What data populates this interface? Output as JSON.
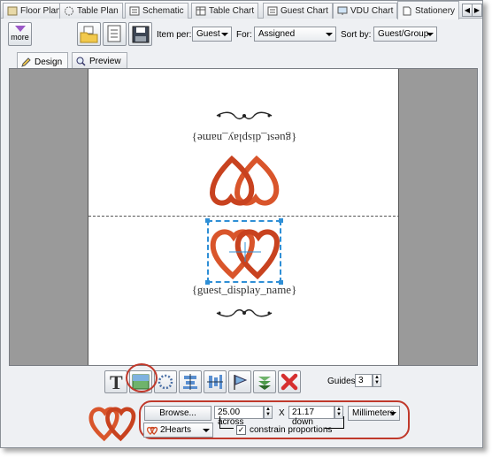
{
  "tabs": [
    {
      "label": "Floor Plan",
      "icon": "floor-plan-icon"
    },
    {
      "label": "Table Plan",
      "icon": "table-plan-icon"
    },
    {
      "label": "Schematic",
      "icon": "schematic-icon"
    },
    {
      "label": "Table Chart",
      "icon": "table-chart-icon"
    },
    {
      "label": "Guest Chart",
      "icon": "guest-chart-icon"
    },
    {
      "label": "VDU Chart",
      "icon": "vdu-chart-icon"
    },
    {
      "label": "Stationery",
      "icon": "stationery-icon",
      "active": true
    }
  ],
  "toolbar": {
    "more_label": "more",
    "item_per_label": "Item per:",
    "item_per_value": "Guest",
    "for_label": "For:",
    "for_value": "Assigned",
    "sort_by_label": "Sort by:",
    "sort_by_value": "Guest/Group"
  },
  "view_tabs": [
    {
      "label": "Design",
      "active": true
    },
    {
      "label": "Preview",
      "active": false
    }
  ],
  "card": {
    "name_placeholder": "{guest_display_name}"
  },
  "tools": {
    "guides_label": "Guides:",
    "guides_value": "3"
  },
  "image_panel": {
    "browse_label": "Browse...",
    "width_value": "25.00 across",
    "x_label": "X",
    "height_value": "21.17 down",
    "units_value": "Millimeters",
    "image_name": "2Hearts",
    "constrain_label": "constrain proportions",
    "constrain_checked": true
  },
  "colors": {
    "accent_annotation": "#c0392b",
    "selection": "#2f8fd6",
    "heart": "#d9552b"
  }
}
